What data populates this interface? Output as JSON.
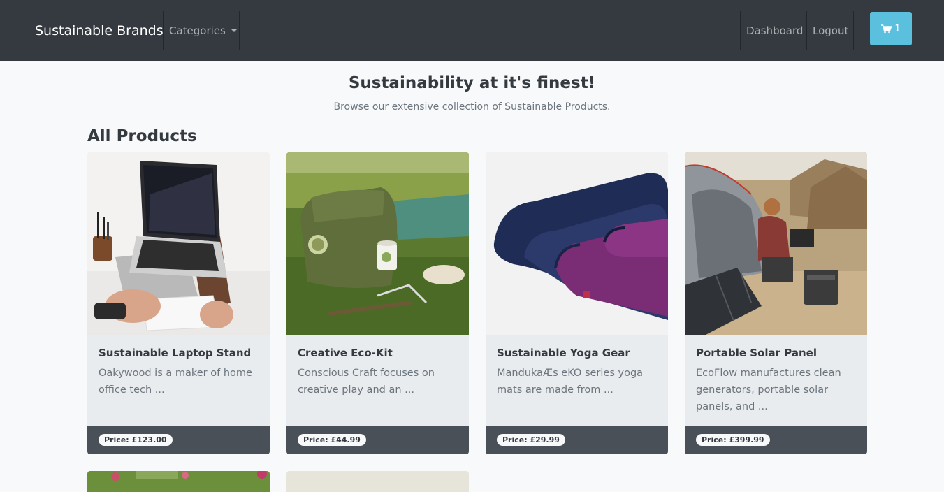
{
  "navbar": {
    "brand": "Sustainable Brands",
    "categories_label": "Categories",
    "dashboard_label": "Dashboard",
    "logout_label": "Logout",
    "cart_count": "1",
    "cart_icon": "shopping-cart-icon",
    "cart_color": "#5bc0de"
  },
  "hero": {
    "title": "Sustainability at it's finest!",
    "subtitle": "Browse our extensive collection of Sustainable Products."
  },
  "section_title": "All Products",
  "products": [
    {
      "title": "Sustainable Laptop Stand",
      "description": "Oakywood is a maker of home office tech ...",
      "price": "Price: £123.00"
    },
    {
      "title": "Creative Eco-Kit",
      "description": "Conscious Craft focuses on creative play and an ...",
      "price": "Price: £44.99"
    },
    {
      "title": "Sustainable Yoga Gear",
      "description": "MandukaÆs eKO series yoga mats are made from ...",
      "price": "Price: £29.99"
    },
    {
      "title": "Portable Solar Panel",
      "description": "EcoFlow manufactures clean generators, portable solar panels, and ...",
      "price": "Price: £399.99"
    }
  ]
}
